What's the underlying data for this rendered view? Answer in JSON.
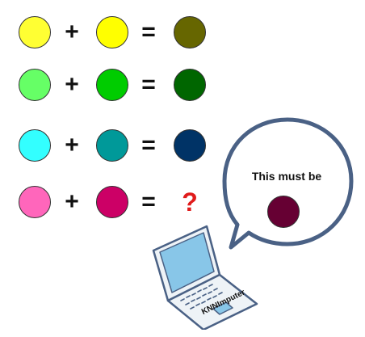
{
  "operators": {
    "plus": "+",
    "equals": "="
  },
  "rows": [
    {
      "input_a": "#ffff33",
      "input_b": "#ffff00",
      "result": "#666600"
    },
    {
      "input_a": "#66ff66",
      "input_b": "#00cc00",
      "result": "#006600"
    },
    {
      "input_a": "#33ffff",
      "input_b": "#009999",
      "result": "#003366"
    },
    {
      "input_a": "#ff66bb",
      "input_b": "#cc0066",
      "result": null
    }
  ],
  "unknown_marker": "?",
  "unknown_marker_color": "#e01b1b",
  "speech_bubble": {
    "text": "This must be",
    "answer_color": "#660033",
    "outline_color": "#4a6185"
  },
  "laptop": {
    "label": "KNNImputer",
    "screen_color": "#88c6e8",
    "body_color": "#eef3f7",
    "outline_color": "#4a6185",
    "icon": "laptop-icon"
  }
}
